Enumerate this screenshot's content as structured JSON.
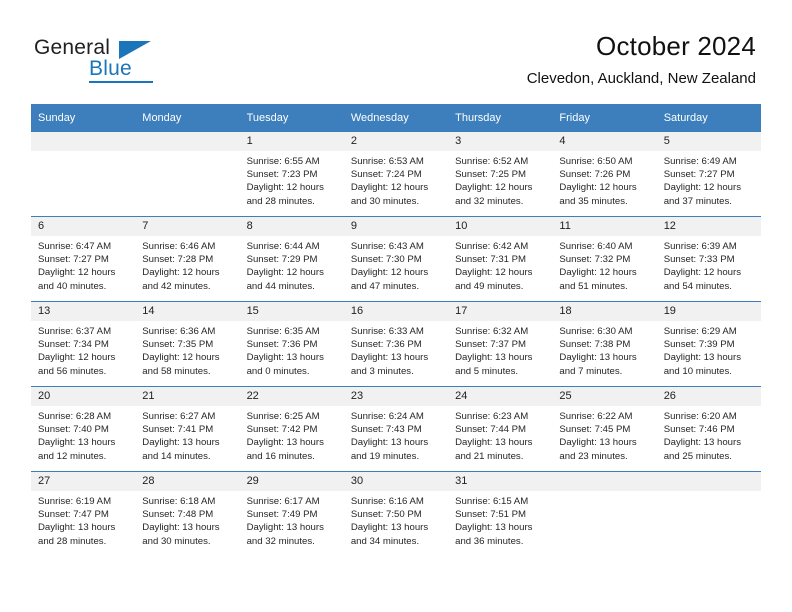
{
  "brand": {
    "name_primary": "General",
    "name_secondary": "Blue",
    "accent_color": "#1b75bb"
  },
  "header": {
    "title": "October 2024",
    "subtitle": "Clevedon, Auckland, New Zealand"
  },
  "calendar": {
    "header_bg": "#3d7ebc",
    "daynum_bg": "#f1f1f1",
    "weekday_headers": [
      "Sunday",
      "Monday",
      "Tuesday",
      "Wednesday",
      "Thursday",
      "Friday",
      "Saturday"
    ],
    "weeks": [
      [
        {
          "day": "",
          "sunrise": "",
          "sunset": "",
          "daylight1": "",
          "daylight2": ""
        },
        {
          "day": "",
          "sunrise": "",
          "sunset": "",
          "daylight1": "",
          "daylight2": ""
        },
        {
          "day": "1",
          "sunrise": "Sunrise: 6:55 AM",
          "sunset": "Sunset: 7:23 PM",
          "daylight1": "Daylight: 12 hours",
          "daylight2": "and 28 minutes."
        },
        {
          "day": "2",
          "sunrise": "Sunrise: 6:53 AM",
          "sunset": "Sunset: 7:24 PM",
          "daylight1": "Daylight: 12 hours",
          "daylight2": "and 30 minutes."
        },
        {
          "day": "3",
          "sunrise": "Sunrise: 6:52 AM",
          "sunset": "Sunset: 7:25 PM",
          "daylight1": "Daylight: 12 hours",
          "daylight2": "and 32 minutes."
        },
        {
          "day": "4",
          "sunrise": "Sunrise: 6:50 AM",
          "sunset": "Sunset: 7:26 PM",
          "daylight1": "Daylight: 12 hours",
          "daylight2": "and 35 minutes."
        },
        {
          "day": "5",
          "sunrise": "Sunrise: 6:49 AM",
          "sunset": "Sunset: 7:27 PM",
          "daylight1": "Daylight: 12 hours",
          "daylight2": "and 37 minutes."
        }
      ],
      [
        {
          "day": "6",
          "sunrise": "Sunrise: 6:47 AM",
          "sunset": "Sunset: 7:27 PM",
          "daylight1": "Daylight: 12 hours",
          "daylight2": "and 40 minutes."
        },
        {
          "day": "7",
          "sunrise": "Sunrise: 6:46 AM",
          "sunset": "Sunset: 7:28 PM",
          "daylight1": "Daylight: 12 hours",
          "daylight2": "and 42 minutes."
        },
        {
          "day": "8",
          "sunrise": "Sunrise: 6:44 AM",
          "sunset": "Sunset: 7:29 PM",
          "daylight1": "Daylight: 12 hours",
          "daylight2": "and 44 minutes."
        },
        {
          "day": "9",
          "sunrise": "Sunrise: 6:43 AM",
          "sunset": "Sunset: 7:30 PM",
          "daylight1": "Daylight: 12 hours",
          "daylight2": "and 47 minutes."
        },
        {
          "day": "10",
          "sunrise": "Sunrise: 6:42 AM",
          "sunset": "Sunset: 7:31 PM",
          "daylight1": "Daylight: 12 hours",
          "daylight2": "and 49 minutes."
        },
        {
          "day": "11",
          "sunrise": "Sunrise: 6:40 AM",
          "sunset": "Sunset: 7:32 PM",
          "daylight1": "Daylight: 12 hours",
          "daylight2": "and 51 minutes."
        },
        {
          "day": "12",
          "sunrise": "Sunrise: 6:39 AM",
          "sunset": "Sunset: 7:33 PM",
          "daylight1": "Daylight: 12 hours",
          "daylight2": "and 54 minutes."
        }
      ],
      [
        {
          "day": "13",
          "sunrise": "Sunrise: 6:37 AM",
          "sunset": "Sunset: 7:34 PM",
          "daylight1": "Daylight: 12 hours",
          "daylight2": "and 56 minutes."
        },
        {
          "day": "14",
          "sunrise": "Sunrise: 6:36 AM",
          "sunset": "Sunset: 7:35 PM",
          "daylight1": "Daylight: 12 hours",
          "daylight2": "and 58 minutes."
        },
        {
          "day": "15",
          "sunrise": "Sunrise: 6:35 AM",
          "sunset": "Sunset: 7:36 PM",
          "daylight1": "Daylight: 13 hours",
          "daylight2": "and 0 minutes."
        },
        {
          "day": "16",
          "sunrise": "Sunrise: 6:33 AM",
          "sunset": "Sunset: 7:36 PM",
          "daylight1": "Daylight: 13 hours",
          "daylight2": "and 3 minutes."
        },
        {
          "day": "17",
          "sunrise": "Sunrise: 6:32 AM",
          "sunset": "Sunset: 7:37 PM",
          "daylight1": "Daylight: 13 hours",
          "daylight2": "and 5 minutes."
        },
        {
          "day": "18",
          "sunrise": "Sunrise: 6:30 AM",
          "sunset": "Sunset: 7:38 PM",
          "daylight1": "Daylight: 13 hours",
          "daylight2": "and 7 minutes."
        },
        {
          "day": "19",
          "sunrise": "Sunrise: 6:29 AM",
          "sunset": "Sunset: 7:39 PM",
          "daylight1": "Daylight: 13 hours",
          "daylight2": "and 10 minutes."
        }
      ],
      [
        {
          "day": "20",
          "sunrise": "Sunrise: 6:28 AM",
          "sunset": "Sunset: 7:40 PM",
          "daylight1": "Daylight: 13 hours",
          "daylight2": "and 12 minutes."
        },
        {
          "day": "21",
          "sunrise": "Sunrise: 6:27 AM",
          "sunset": "Sunset: 7:41 PM",
          "daylight1": "Daylight: 13 hours",
          "daylight2": "and 14 minutes."
        },
        {
          "day": "22",
          "sunrise": "Sunrise: 6:25 AM",
          "sunset": "Sunset: 7:42 PM",
          "daylight1": "Daylight: 13 hours",
          "daylight2": "and 16 minutes."
        },
        {
          "day": "23",
          "sunrise": "Sunrise: 6:24 AM",
          "sunset": "Sunset: 7:43 PM",
          "daylight1": "Daylight: 13 hours",
          "daylight2": "and 19 minutes."
        },
        {
          "day": "24",
          "sunrise": "Sunrise: 6:23 AM",
          "sunset": "Sunset: 7:44 PM",
          "daylight1": "Daylight: 13 hours",
          "daylight2": "and 21 minutes."
        },
        {
          "day": "25",
          "sunrise": "Sunrise: 6:22 AM",
          "sunset": "Sunset: 7:45 PM",
          "daylight1": "Daylight: 13 hours",
          "daylight2": "and 23 minutes."
        },
        {
          "day": "26",
          "sunrise": "Sunrise: 6:20 AM",
          "sunset": "Sunset: 7:46 PM",
          "daylight1": "Daylight: 13 hours",
          "daylight2": "and 25 minutes."
        }
      ],
      [
        {
          "day": "27",
          "sunrise": "Sunrise: 6:19 AM",
          "sunset": "Sunset: 7:47 PM",
          "daylight1": "Daylight: 13 hours",
          "daylight2": "and 28 minutes."
        },
        {
          "day": "28",
          "sunrise": "Sunrise: 6:18 AM",
          "sunset": "Sunset: 7:48 PM",
          "daylight1": "Daylight: 13 hours",
          "daylight2": "and 30 minutes."
        },
        {
          "day": "29",
          "sunrise": "Sunrise: 6:17 AM",
          "sunset": "Sunset: 7:49 PM",
          "daylight1": "Daylight: 13 hours",
          "daylight2": "and 32 minutes."
        },
        {
          "day": "30",
          "sunrise": "Sunrise: 6:16 AM",
          "sunset": "Sunset: 7:50 PM",
          "daylight1": "Daylight: 13 hours",
          "daylight2": "and 34 minutes."
        },
        {
          "day": "31",
          "sunrise": "Sunrise: 6:15 AM",
          "sunset": "Sunset: 7:51 PM",
          "daylight1": "Daylight: 13 hours",
          "daylight2": "and 36 minutes."
        },
        {
          "day": "",
          "sunrise": "",
          "sunset": "",
          "daylight1": "",
          "daylight2": ""
        },
        {
          "day": "",
          "sunrise": "",
          "sunset": "",
          "daylight1": "",
          "daylight2": ""
        }
      ]
    ]
  }
}
